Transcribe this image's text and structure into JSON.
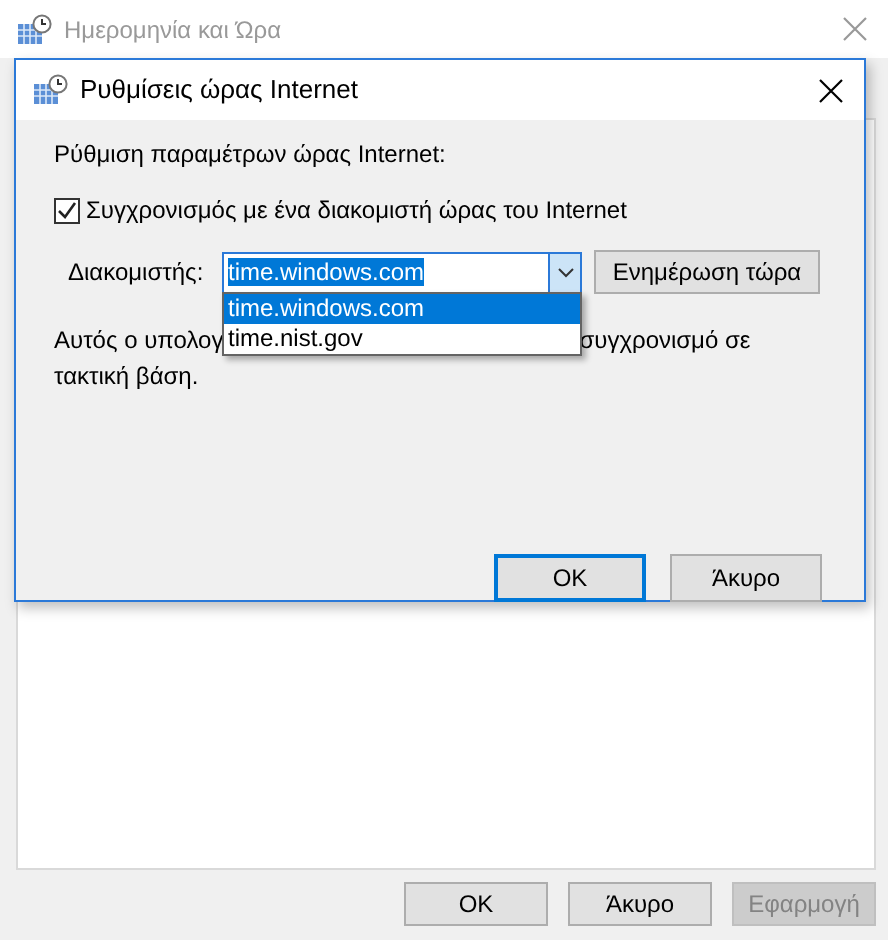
{
  "main_window": {
    "title": "Ημερομηνία και Ώρα",
    "buttons": [
      {
        "label": "OK",
        "disabled": false
      },
      {
        "label": "Άκυρο",
        "disabled": false
      },
      {
        "label": "Εφαρμογή",
        "disabled": true
      }
    ]
  },
  "dialog": {
    "title": "Ρυθμίσεις ώρας Internet",
    "heading": "Ρύθμιση παραμέτρων ώρας Internet:",
    "sync_checkbox": {
      "label": "Συγχρονισμός με ένα διακομιστή ώρας του Internet",
      "checked": true
    },
    "server_label": "Διακομιστής:",
    "server_field": {
      "value": "time.windows.com"
    },
    "dropdown_options": [
      {
        "label": "time.windows.com",
        "selected": true
      },
      {
        "label": "time.nist.gov",
        "selected": false
      }
    ],
    "update_button": "Ενημέρωση τώρα",
    "description": {
      "line_1_start": "Αυτός ο υπολογ",
      "line_1_end": "συγχρονισμό σε",
      "line_2": "τακτική βάση."
    },
    "buttons": [
      {
        "label": "OK",
        "default": true
      },
      {
        "label": "Άκυρο",
        "default": false
      }
    ]
  }
}
